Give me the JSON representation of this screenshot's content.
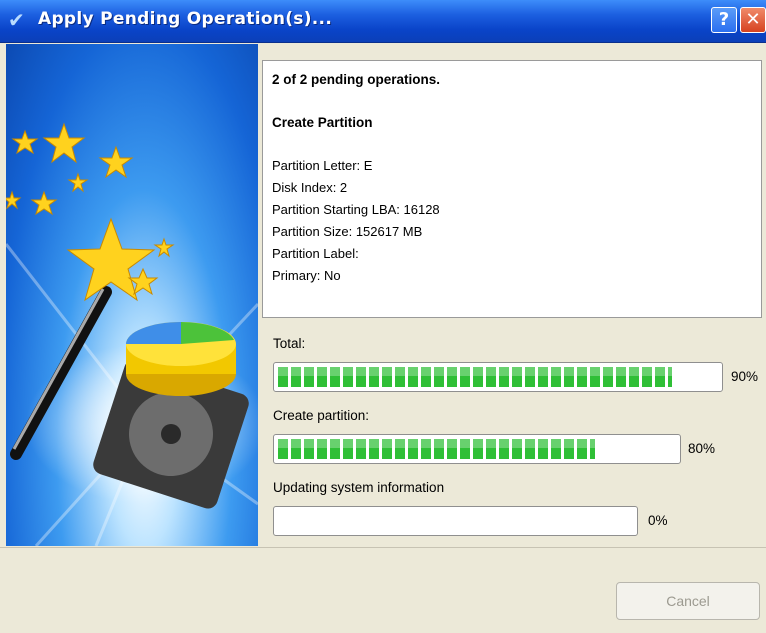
{
  "window": {
    "title": "Apply Pending Operation(s)...",
    "help_label": "?",
    "close_label": "✕"
  },
  "info": {
    "summary": "2 of 2 pending operations.",
    "operation": "Create Partition",
    "details": [
      "Partition Letter: E",
      "Disk Index: 2",
      "Partition Starting LBA: 16128",
      "Partition Size: 152617 MB",
      "Partition Label:",
      "Primary: No"
    ]
  },
  "progress": [
    {
      "label": "Total:",
      "percent_text": "90%",
      "value": 0.9
    },
    {
      "label": "Create partition:",
      "percent_text": "80%",
      "value": 0.8
    },
    {
      "label": "Updating system information",
      "percent_text": "0%",
      "value": 0.0
    }
  ],
  "buttons": {
    "cancel": "Cancel"
  },
  "icons": {
    "title": "check-icon",
    "art": "magic-wand-disk-illustration"
  },
  "colors": {
    "titlebar": "#0a44c9",
    "progress_fill": "#2fbf36",
    "dialog_bg": "#ece9d8"
  }
}
